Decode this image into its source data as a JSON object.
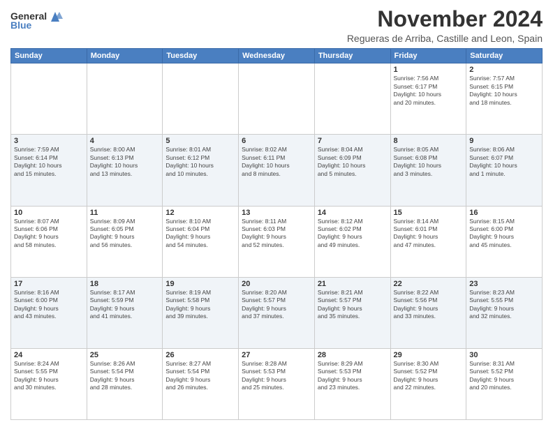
{
  "header": {
    "logo_general": "General",
    "logo_blue": "Blue",
    "month": "November 2024",
    "location": "Regueras de Arriba, Castille and Leon, Spain"
  },
  "weekdays": [
    "Sunday",
    "Monday",
    "Tuesday",
    "Wednesday",
    "Thursday",
    "Friday",
    "Saturday"
  ],
  "weeks": [
    [
      {
        "day": "",
        "info": ""
      },
      {
        "day": "",
        "info": ""
      },
      {
        "day": "",
        "info": ""
      },
      {
        "day": "",
        "info": ""
      },
      {
        "day": "",
        "info": ""
      },
      {
        "day": "1",
        "info": "Sunrise: 7:56 AM\nSunset: 6:17 PM\nDaylight: 10 hours\nand 20 minutes."
      },
      {
        "day": "2",
        "info": "Sunrise: 7:57 AM\nSunset: 6:15 PM\nDaylight: 10 hours\nand 18 minutes."
      }
    ],
    [
      {
        "day": "3",
        "info": "Sunrise: 7:59 AM\nSunset: 6:14 PM\nDaylight: 10 hours\nand 15 minutes."
      },
      {
        "day": "4",
        "info": "Sunrise: 8:00 AM\nSunset: 6:13 PM\nDaylight: 10 hours\nand 13 minutes."
      },
      {
        "day": "5",
        "info": "Sunrise: 8:01 AM\nSunset: 6:12 PM\nDaylight: 10 hours\nand 10 minutes."
      },
      {
        "day": "6",
        "info": "Sunrise: 8:02 AM\nSunset: 6:11 PM\nDaylight: 10 hours\nand 8 minutes."
      },
      {
        "day": "7",
        "info": "Sunrise: 8:04 AM\nSunset: 6:09 PM\nDaylight: 10 hours\nand 5 minutes."
      },
      {
        "day": "8",
        "info": "Sunrise: 8:05 AM\nSunset: 6:08 PM\nDaylight: 10 hours\nand 3 minutes."
      },
      {
        "day": "9",
        "info": "Sunrise: 8:06 AM\nSunset: 6:07 PM\nDaylight: 10 hours\nand 1 minute."
      }
    ],
    [
      {
        "day": "10",
        "info": "Sunrise: 8:07 AM\nSunset: 6:06 PM\nDaylight: 9 hours\nand 58 minutes."
      },
      {
        "day": "11",
        "info": "Sunrise: 8:09 AM\nSunset: 6:05 PM\nDaylight: 9 hours\nand 56 minutes."
      },
      {
        "day": "12",
        "info": "Sunrise: 8:10 AM\nSunset: 6:04 PM\nDaylight: 9 hours\nand 54 minutes."
      },
      {
        "day": "13",
        "info": "Sunrise: 8:11 AM\nSunset: 6:03 PM\nDaylight: 9 hours\nand 52 minutes."
      },
      {
        "day": "14",
        "info": "Sunrise: 8:12 AM\nSunset: 6:02 PM\nDaylight: 9 hours\nand 49 minutes."
      },
      {
        "day": "15",
        "info": "Sunrise: 8:14 AM\nSunset: 6:01 PM\nDaylight: 9 hours\nand 47 minutes."
      },
      {
        "day": "16",
        "info": "Sunrise: 8:15 AM\nSunset: 6:00 PM\nDaylight: 9 hours\nand 45 minutes."
      }
    ],
    [
      {
        "day": "17",
        "info": "Sunrise: 8:16 AM\nSunset: 6:00 PM\nDaylight: 9 hours\nand 43 minutes."
      },
      {
        "day": "18",
        "info": "Sunrise: 8:17 AM\nSunset: 5:59 PM\nDaylight: 9 hours\nand 41 minutes."
      },
      {
        "day": "19",
        "info": "Sunrise: 8:19 AM\nSunset: 5:58 PM\nDaylight: 9 hours\nand 39 minutes."
      },
      {
        "day": "20",
        "info": "Sunrise: 8:20 AM\nSunset: 5:57 PM\nDaylight: 9 hours\nand 37 minutes."
      },
      {
        "day": "21",
        "info": "Sunrise: 8:21 AM\nSunset: 5:57 PM\nDaylight: 9 hours\nand 35 minutes."
      },
      {
        "day": "22",
        "info": "Sunrise: 8:22 AM\nSunset: 5:56 PM\nDaylight: 9 hours\nand 33 minutes."
      },
      {
        "day": "23",
        "info": "Sunrise: 8:23 AM\nSunset: 5:55 PM\nDaylight: 9 hours\nand 32 minutes."
      }
    ],
    [
      {
        "day": "24",
        "info": "Sunrise: 8:24 AM\nSunset: 5:55 PM\nDaylight: 9 hours\nand 30 minutes."
      },
      {
        "day": "25",
        "info": "Sunrise: 8:26 AM\nSunset: 5:54 PM\nDaylight: 9 hours\nand 28 minutes."
      },
      {
        "day": "26",
        "info": "Sunrise: 8:27 AM\nSunset: 5:54 PM\nDaylight: 9 hours\nand 26 minutes."
      },
      {
        "day": "27",
        "info": "Sunrise: 8:28 AM\nSunset: 5:53 PM\nDaylight: 9 hours\nand 25 minutes."
      },
      {
        "day": "28",
        "info": "Sunrise: 8:29 AM\nSunset: 5:53 PM\nDaylight: 9 hours\nand 23 minutes."
      },
      {
        "day": "29",
        "info": "Sunrise: 8:30 AM\nSunset: 5:52 PM\nDaylight: 9 hours\nand 22 minutes."
      },
      {
        "day": "30",
        "info": "Sunrise: 8:31 AM\nSunset: 5:52 PM\nDaylight: 9 hours\nand 20 minutes."
      }
    ]
  ]
}
